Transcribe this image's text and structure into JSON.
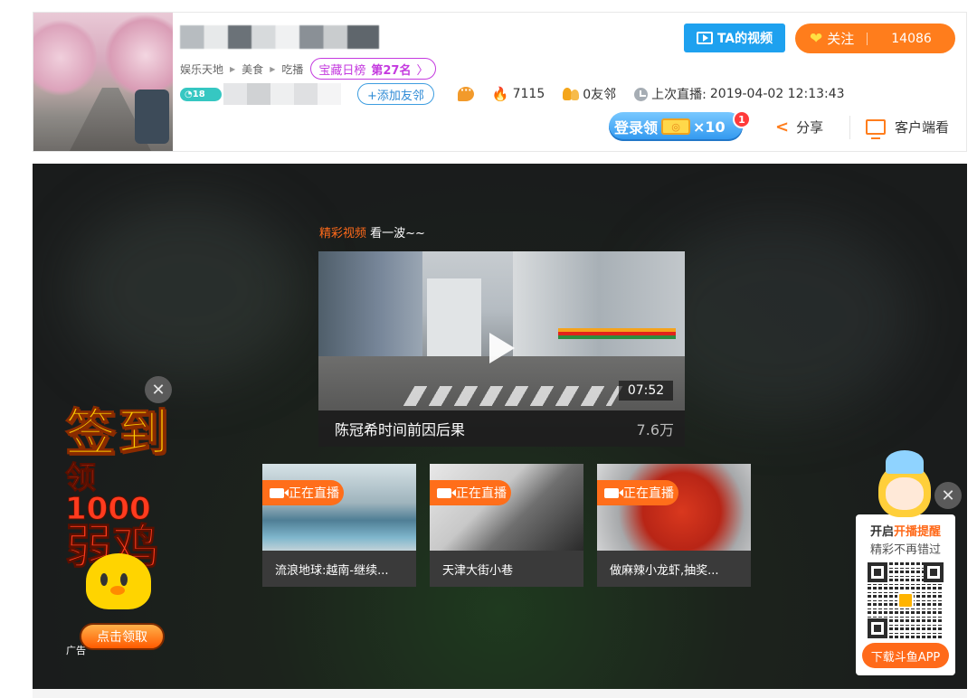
{
  "header": {
    "breadcrumb": [
      "娱乐天地",
      "美食",
      "吃播"
    ],
    "rank": {
      "label": "宝藏日榜",
      "value": "第27名",
      "arrow": "〉"
    },
    "level_badge": "18",
    "add_friend_label": "+添加友邻",
    "heat_value": "7115",
    "friends_value": "0友邻",
    "last_live_label": "上次直播:",
    "last_live_time": "2019-04-02 12:13:43",
    "ta_video_label": "TA的视频",
    "follow": {
      "label": "关注",
      "count": "14086"
    },
    "login_reward": {
      "label": "登录领",
      "count": "×10",
      "badge": "1"
    },
    "share_label": "分享",
    "client_label": "客户端看"
  },
  "player": {
    "highlight": {
      "orange": "精彩视频",
      "rest": "看一波~~"
    },
    "main_video": {
      "title": "陈冠希时间前因后果",
      "duration": "07:52",
      "views": "7.6万"
    },
    "live_badge": "正在直播",
    "live_cards": [
      {
        "title": "流浪地球:越南-继续..."
      },
      {
        "title": "天津大街小巷"
      },
      {
        "title": "做麻辣小龙虾,抽奖..."
      }
    ]
  },
  "left_ad": {
    "line1": "签到",
    "line2": "领1000",
    "line3": "弱鸡",
    "claim_label": "点击领取",
    "ad_tag": "广告",
    "close_glyph": "✕"
  },
  "qr_panel": {
    "title_prefix": "开启",
    "title_highlight": "开播提醒",
    "subtitle": "精彩不再错过",
    "download_label": "下载斗鱼APP",
    "close_glyph": "✕"
  },
  "icons": {
    "fire": "🔥",
    "heart": "❤",
    "share": "<",
    "play": "play-triangle"
  },
  "colors": {
    "accent_orange": "#ff7d1c",
    "accent_blue": "#1ea1ef",
    "rank_purple": "#c43adf",
    "live_orange": "#ff6e1a"
  }
}
